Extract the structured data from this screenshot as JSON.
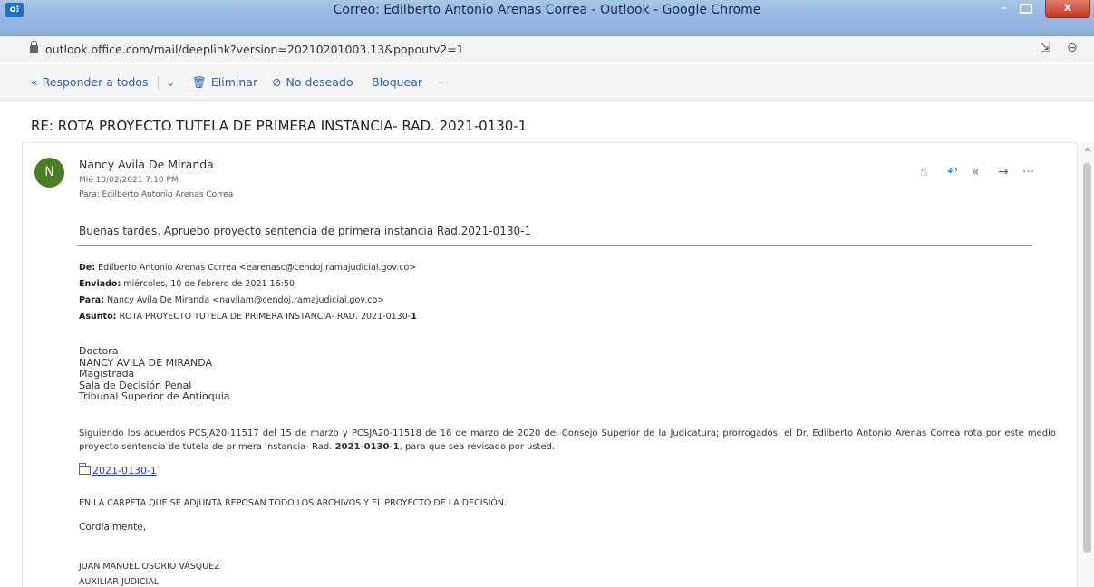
{
  "window": {
    "app_icon": "outlook-icon",
    "title": "Correo: Edilberto Antonio Arenas Correa - Outlook - Google Chrome",
    "minimize_symbol": "–",
    "close_symbol": "x"
  },
  "address_bar": {
    "url": "outlook.office.com/mail/deeplink?version=20210201003.13&popoutv2=1"
  },
  "toolbar": {
    "reply_all_label": "Responder a todos",
    "delete_label": "Eliminar",
    "junk_label": "No deseado",
    "block_label": "Bloquear",
    "more_label": "···"
  },
  "email": {
    "subject": "RE: ROTA PROYECTO TUTELA DE PRIMERA INSTANCIA- RAD. 2021-0130-1",
    "avatar_initial": "N",
    "sender": "Nancy Avila De Miranda",
    "date": "Mié 10/02/2021 7:10 PM",
    "to": "Para: Edilberto Antonio Arenas Correa",
    "body_intro": "Buenas tardes. Apruebo proyecto sentencia de primera instancia Rad.2021-0130-1",
    "quoted": {
      "from_label": "De:",
      "from_value": "Edilberto Antonio Arenas Correa <earenasc@cendoj.ramajudicial.gov.co>",
      "sent_label": "Enviado:",
      "sent_value": "miércoles, 10 de febrero de 2021 16:50",
      "to_label": "Para:",
      "to_value": "Nancy Avila De Miranda <navilam@cendoj.ramajudicial.gov.co>",
      "subject_label": "Asunto:",
      "subject_value": "ROTA PROYECTO TUTELA DE PRIMERA INSTANCIA- RAD. 2021-0130-",
      "subject_value_bold": "1"
    },
    "recipient_block": [
      "Doctora",
      "NANCY AVILA DE MIRANDA",
      "Magistrada",
      "Sala de Decisión Penal",
      "Tribunal Superior de Antioquia"
    ],
    "paragraph_part1": "Siguiendo los acuerdos PCSJA20-11517 del 15 de marzo y PCSJA20-11518 de 16 de marzo de 2020 del Consejo Superior de la Judicatura; prorrogados, el Dr. Edilberto Antonio Arenas Correa rota por este medio proyecto sentencia de tutela de primera instancia- Rad. ",
    "paragraph_bold": "2021-0130-1",
    "paragraph_part2": ", para que sea revisado por usted.",
    "attachment_link": "2021-0130-1",
    "folder_note": "EN LA CARPETA QUE SE ADJUNTA REPOSAN TODO LOS ARCHIVOS Y EL PROYECTO DE LA DECISIÓN.",
    "closing": "Cordialmente,",
    "signature_name": "JUAN MANUEL OSORIO VÁSQUEZ",
    "signature_title": "AUXILIAR JUDICIAL"
  },
  "icons": {
    "reply_all": "reply-all-icon",
    "delete": "trash-icon",
    "junk": "block-circle-icon",
    "like": "thumbs-up-icon",
    "reply": "reply-icon",
    "forward": "forward-icon"
  }
}
